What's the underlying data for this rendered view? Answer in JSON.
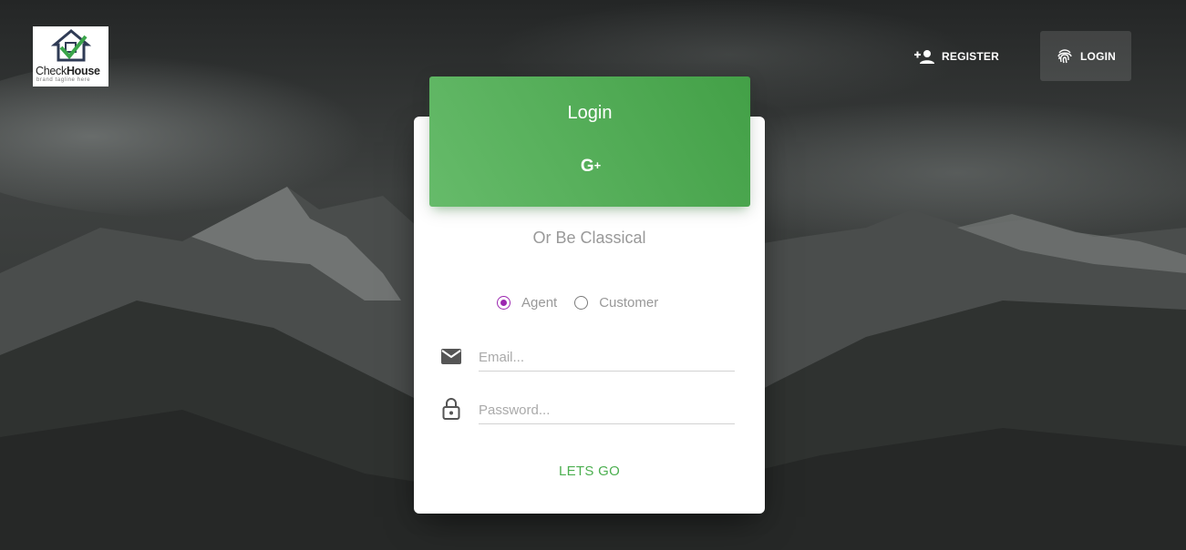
{
  "brand": {
    "name_regular": "Check",
    "name_bold": "House",
    "tagline": "brand tagline here"
  },
  "nav": {
    "register_label": "REGISTER",
    "login_label": "LOGIN"
  },
  "login_card": {
    "title": "Login",
    "social_icon": "google-plus-icon",
    "social_label": "G",
    "social_plus": "+",
    "subtitle": "Or Be Classical",
    "roles": [
      {
        "label": "Agent",
        "checked": true
      },
      {
        "label": "Customer",
        "checked": false
      }
    ],
    "email_placeholder": "Email...",
    "password_placeholder": "Password...",
    "submit_label": "LETS GO"
  },
  "colors": {
    "accent_green": "#4caf50",
    "radio_purple": "#9c27b0"
  }
}
